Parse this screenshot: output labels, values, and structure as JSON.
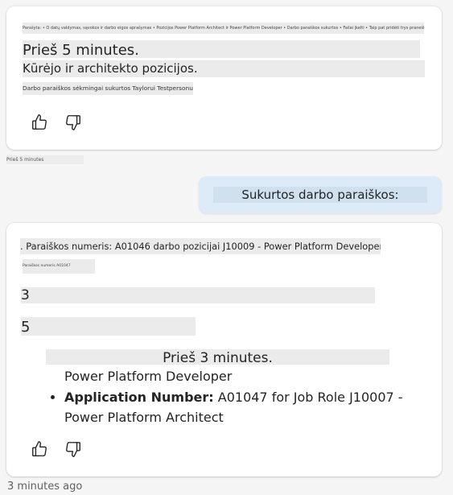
{
  "messages": [
    {
      "scrambled_header": "Parašyta: • O datų valdymas, sąvokos ir darbo eigos aprašymas • Pozicijos Power Platform Architect ir Power Platform Developer • Darbo paraiškos sukurtos • Failai įkelti • Taip pat pridėti trys pranešimai",
      "time": "Prieš 5 minutes.",
      "subtitle": "Kūrėjo ir architekto pozicijos.",
      "note": "Darbo paraiškos sėkmingai sukurtos Taylorui Testpersonui.",
      "actions": {
        "like_label": "Patinka",
        "dislike_label": "Nepatinka"
      }
    },
    {
      "timestamp_scrambled": "Prieš 5 minutes"
    },
    {
      "user_text": "Sukurtos darbo paraiškos:"
    },
    {
      "line1": ". Paraiškos numeris: A01046 darbo pozicijai J10009 - Power Platform Developer",
      "line2_scrambled": "Paraiškos numeris A01047",
      "num_a": "3",
      "num_b": "5",
      "time": "Prieš 3 minutes.",
      "prev_item_tail": "Power Platform Developer",
      "list_items": [
        {
          "label": "Application Number:",
          "text": " A01047 for Job Role J10007 - Power Platform Architect"
        }
      ],
      "actions": {
        "like_label": "Patinka",
        "dislike_label": "Nepatinka"
      }
    }
  ],
  "footer": {
    "timestamp": "3 minutes ago"
  },
  "icons": {
    "like": "thumbs-up-icon",
    "dislike": "thumbs-down-icon"
  },
  "colors": {
    "background": "#f5f5f5",
    "card": "#ffffff",
    "user_bubble": "#dcebf7",
    "highlight": "#ebebeb"
  }
}
